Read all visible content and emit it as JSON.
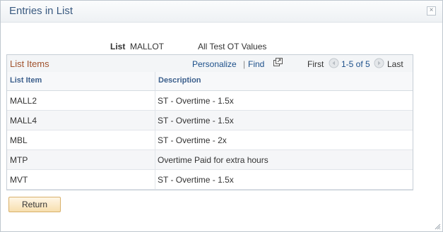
{
  "dialog": {
    "title": "Entries in List"
  },
  "list_info": {
    "label": "List",
    "code": "MALLOT",
    "description": "All Test OT Values"
  },
  "grid": {
    "title": "List Items",
    "personalize": "Personalize",
    "separator": "|",
    "find": "Find",
    "first": "First",
    "range": "1-5 of 5",
    "last": "Last",
    "columns": [
      "List Item",
      "Description"
    ],
    "rows": [
      {
        "item": "MALL2",
        "description": "ST - Overtime - 1.5x"
      },
      {
        "item": "MALL4",
        "description": "ST - Overtime - 1.5x"
      },
      {
        "item": "MBL",
        "description": "ST - Overtime - 2x"
      },
      {
        "item": "MTP",
        "description": "Overtime Paid for extra hours"
      },
      {
        "item": "MVT",
        "description": "ST - Overtime - 1.5x"
      }
    ]
  },
  "buttons": {
    "return_label": "Return",
    "close_glyph": "×"
  },
  "icons": [
    "close-icon",
    "zoom-grid-icon",
    "previous-page-icon",
    "next-page-icon",
    "resize-grip-icon"
  ],
  "colors": {
    "title_text": "#3a5a80",
    "grid_title": "#a0522d",
    "link": "#1b4f8a",
    "button_bg": "#f7dfae"
  }
}
